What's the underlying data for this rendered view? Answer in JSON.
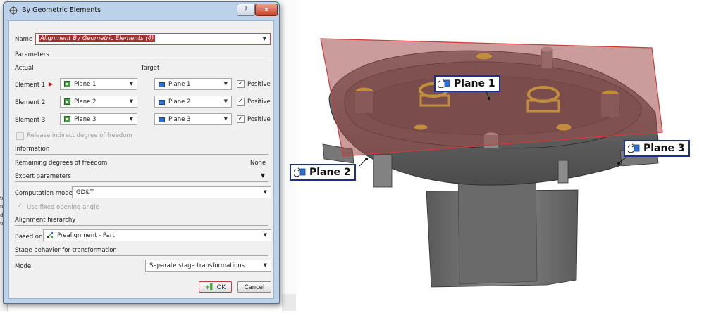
{
  "dialog": {
    "title": "By Geometric Elements",
    "help_button": "?",
    "close_button": "x",
    "name_label": "Name",
    "name_value": "Alignment By Geometric Elements (4)",
    "parameters_heading": "Parameters",
    "actual_label": "Actual",
    "target_label": "Target",
    "elements": [
      {
        "label": "Element 1",
        "actual": "Plane 1",
        "target": "Plane 1",
        "positive_label": "Positive",
        "positive_checked": true
      },
      {
        "label": "Element 2",
        "actual": "Plane 2",
        "target": "Plane 2",
        "positive_label": "Positive",
        "positive_checked": true
      },
      {
        "label": "Element 3",
        "actual": "Plane 3",
        "target": "Plane 3",
        "positive_label": "Positive",
        "positive_checked": true
      }
    ],
    "release_indirect_label": "Release indirect degree of freedom",
    "information_heading": "Information",
    "remaining_dof_label": "Remaining degrees of freedom",
    "remaining_dof_value": "None",
    "expert_heading": "Expert parameters",
    "computation_mode_label": "Computation mode",
    "computation_mode_value": "GD&T",
    "use_fixed_angle_label": "Use fixed opening angle",
    "alignment_hierarchy_heading": "Alignment hierarchy",
    "based_on_label": "Based on",
    "based_on_value": "Prealignment - Part",
    "stage_heading": "Stage behavior for transformation",
    "mode_label": "Mode",
    "mode_value": "Separate stage transformations",
    "ok_label": "OK",
    "cancel_label": "Cancel"
  },
  "viewport": {
    "callouts": [
      {
        "label": "Plane 1"
      },
      {
        "label": "Plane 2"
      },
      {
        "label": "Plane 3"
      }
    ]
  },
  "background": {
    "left_fragments": [
      "tr",
      "tr",
      "d",
      "tr"
    ]
  },
  "colors": {
    "plane_fill": "#a04a4a",
    "plane_edge": "#d23a3a",
    "callout_border": "#1c2f8f",
    "highlight_yellow": "#e8e02a",
    "part_gray": "#6e6e6e"
  }
}
